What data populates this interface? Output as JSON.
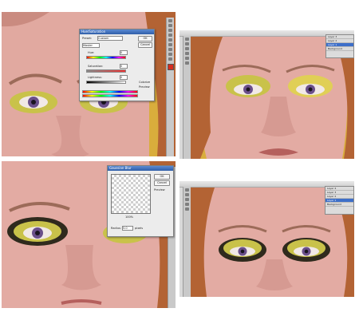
{
  "screenshots": [
    {
      "id": "top-left",
      "dialog": {
        "title": "Hue/Saturation",
        "preset_label": "Preset:",
        "preset_value": "Custom",
        "edit_value": "Master",
        "hue_label": "Hue:",
        "hue_value": "0",
        "saturation_label": "Saturation:",
        "saturation_value": "0",
        "lightness_label": "Lightness:",
        "lightness_value": "0",
        "ok_label": "OK",
        "cancel_label": "Cancel",
        "colorize_label": "Colorize",
        "preview_label": "Preview"
      }
    },
    {
      "id": "top-right",
      "layers": [
        "Layer 3",
        "Layer 2",
        "Layer 1",
        "Background"
      ]
    },
    {
      "id": "bottom-left",
      "dialog": {
        "title": "Gaussian Blur",
        "ok_label": "OK",
        "cancel_label": "Cancel",
        "preview_label": "Preview",
        "zoom_value": "100%",
        "radius_label": "Radius:",
        "radius_value": "5.0",
        "radius_unit": "pixels"
      }
    },
    {
      "id": "bottom-right",
      "layers": [
        "Layer 4",
        "Layer 3",
        "Layer 2",
        "Layer 1",
        "Background"
      ]
    }
  ],
  "colors": {
    "skin": "#e3aba3",
    "skin_shadow": "#c9877e",
    "background_yellow": "#d9ad3c",
    "hair": "#b36334",
    "eyeshadow_yellow": "#c9c24a",
    "eyeshadow_green": "#596b29",
    "iris": "#6a4f8a",
    "ps_panel": "#c9c9c9",
    "selection_blue": "#3d6fc9"
  }
}
